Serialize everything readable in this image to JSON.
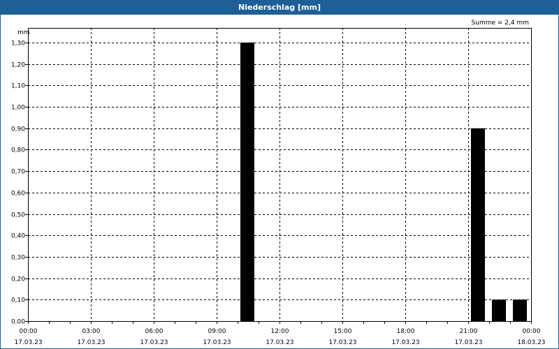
{
  "chart_data": {
    "type": "bar",
    "title": "Niederschlag [mm]",
    "ylabel": "mm",
    "summary": "Summe = 2,4 mm",
    "ylim": [
      0,
      1.3
    ],
    "yticks": [
      "0,00",
      "0,10",
      "0,20",
      "0,30",
      "0,40",
      "0,50",
      "0,60",
      "0,70",
      "0,80",
      "0,90",
      "1,00",
      "1,10",
      "1,20",
      "1,30"
    ],
    "xlim_hours": [
      0,
      24
    ],
    "xticks": [
      {
        "time": "00:00",
        "date": "17.03.23"
      },
      {
        "time": "03:00",
        "date": "17.03.23"
      },
      {
        "time": "06:00",
        "date": "17.03.23"
      },
      {
        "time": "09:00",
        "date": "17.03.23"
      },
      {
        "time": "12:00",
        "date": "17.03.23"
      },
      {
        "time": "15:00",
        "date": "17.03.23"
      },
      {
        "time": "18:00",
        "date": "17.03.23"
      },
      {
        "time": "21:00",
        "date": "17.03.23"
      },
      {
        "time": "00:00",
        "date": "18.03.23"
      }
    ],
    "bars": [
      {
        "hour": 10,
        "value": 1.3
      },
      {
        "hour": 21,
        "value": 0.9
      },
      {
        "hour": 22,
        "value": 0.1
      },
      {
        "hour": 23,
        "value": 0.1
      }
    ],
    "bar_color": "#000000",
    "grid": true
  },
  "colors": {
    "titlebar": "#1e5f96"
  }
}
